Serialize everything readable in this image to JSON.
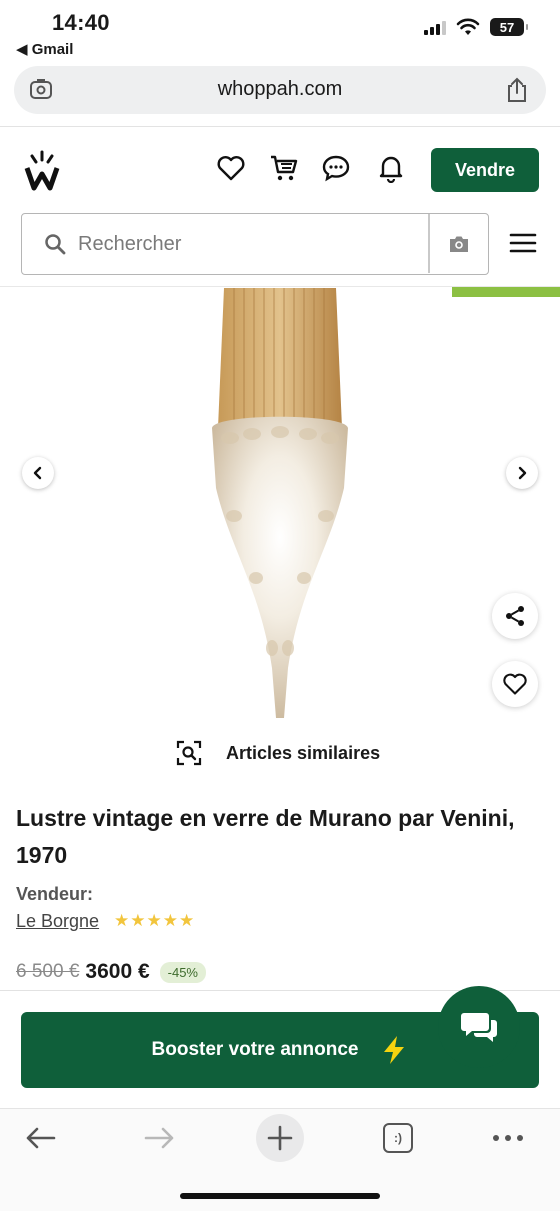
{
  "status_bar": {
    "time": "14:40",
    "back_app": "◀ Gmail",
    "battery": "57"
  },
  "browser": {
    "url": "whoppah.com"
  },
  "header": {
    "sell_label": "Vendre",
    "search_placeholder": "Rechercher"
  },
  "gallery": {
    "similar_label": "Articles similaires"
  },
  "product": {
    "title": "Lustre vintage en verre de Murano par Venini, 1970",
    "seller_label": "Vendeur:",
    "seller_name": "Le Borgne",
    "rating_stars": "★★★★★",
    "old_price": "6 500 €",
    "price": "3600 €",
    "discount": "-45%"
  },
  "cta": {
    "boost_label": "Booster votre annonce"
  },
  "toolbar": {
    "tabs_label": ":)"
  },
  "colors": {
    "brand_green": "#0f5f3a",
    "accent_lime": "#8cc043",
    "star_yellow": "#f2c53d"
  }
}
